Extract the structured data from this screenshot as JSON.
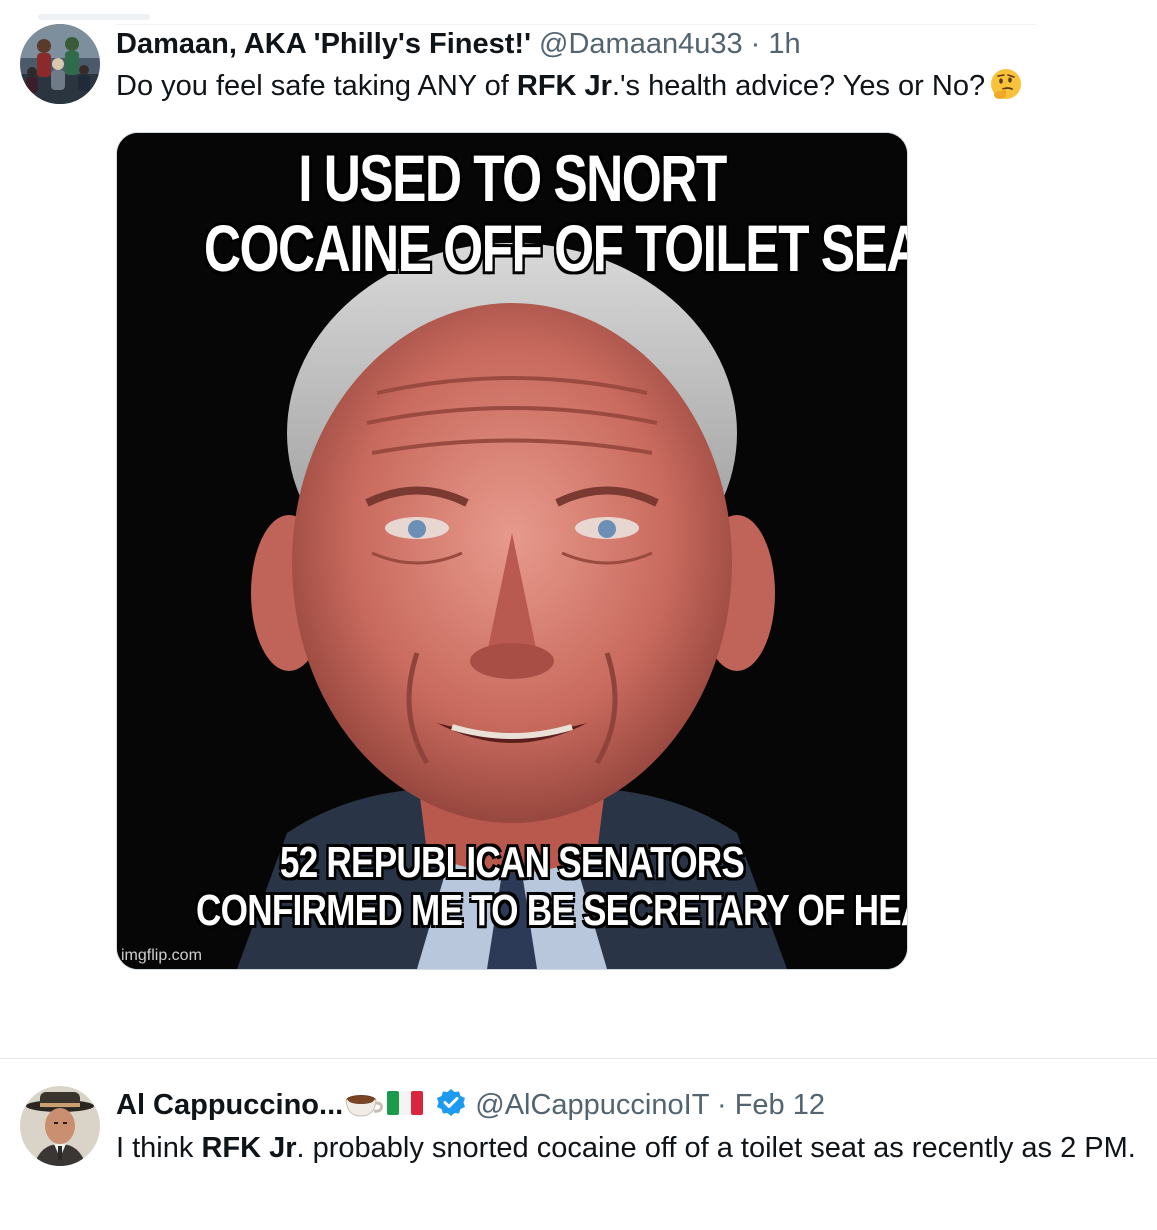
{
  "tweet1": {
    "author_name": "Damaan, AKA 'Philly's Finest!'",
    "handle": "@Damaan4u33",
    "separator": "·",
    "time": "1h",
    "text_before": "Do you feel safe taking ANY of ",
    "text_bold": "RFK Jr",
    "text_after": ".'s health advice?  Yes or No?",
    "emoji_icon": "thinking-face-emoji",
    "media": {
      "top_text_line1": "I USED TO SNORT",
      "top_text_line2": "COCAINE OFF OF TOILET SEATS",
      "bottom_text_line1": "52 REPUBLICAN SENATORS",
      "bottom_text_line2": "CONFIRMED ME TO BE SECRETARY OF HEALTH",
      "watermark": "imgflip.com"
    }
  },
  "tweet2": {
    "author_name": "Al Cappuccino...",
    "name_icons": [
      "coffee-cup-emoji",
      "italy-flag-emoji",
      "verified-badge-icon"
    ],
    "handle": "@AlCappuccinoIT",
    "separator": "·",
    "time": "Feb 12",
    "text_before": "I think ",
    "text_bold": "RFK Jr",
    "text_after": ". probably snorted cocaine off of a toilet seat as recently as 2 PM."
  },
  "colors": {
    "text": "#0f1419",
    "secondary": "#536471",
    "verified": "#1d9bf0",
    "divider": "#e1e6ea"
  }
}
